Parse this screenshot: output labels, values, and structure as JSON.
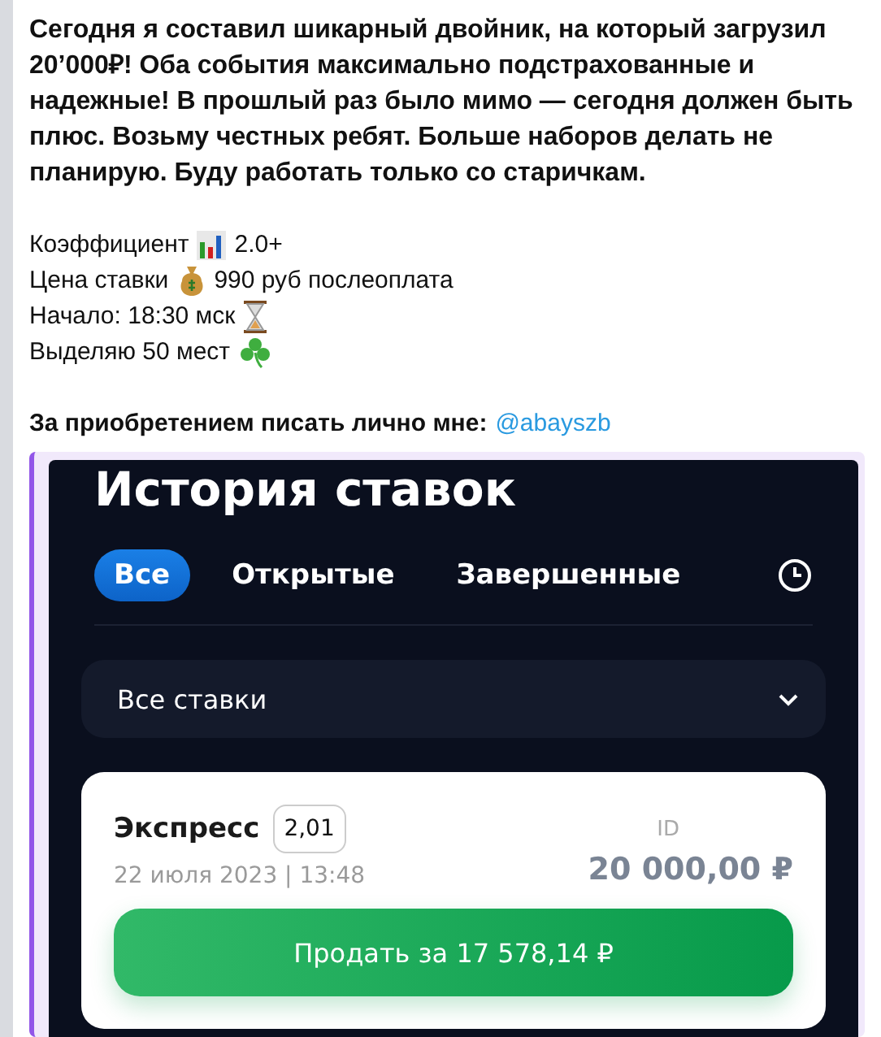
{
  "message": {
    "intro": "Сегодня я составил шикарный двойник, на который загрузил 20’000₽! Оба события максимально подстрахованные и надежные! В прошлый раз было мимо — сегодня должен быть плюс. Возьму честных ребят. Больше наборов делать не планирую. Буду работать только со старичкам.",
    "details": [
      {
        "kind": "chart",
        "before": "Коэффициент",
        "after": "2.0+"
      },
      {
        "kind": "moneybag",
        "before": "Цена ставки",
        "after": "990 руб послеоплата"
      },
      {
        "kind": "hourglass",
        "before": "Начало: 18:30 мск"
      },
      {
        "kind": "clover",
        "before": "Выделяю 50 мест"
      }
    ],
    "contact": {
      "text": "За приобретением писать лично мне:",
      "link": "@abayszb"
    }
  },
  "screenshot": {
    "title": "История ставок",
    "tabs": [
      {
        "label": "Все",
        "selected": true
      },
      {
        "label": "Открытые",
        "selected": false
      },
      {
        "label": "Завершенные",
        "selected": false
      }
    ],
    "filter": {
      "value": "Все ставки"
    },
    "bet": {
      "type": "Экспресс",
      "odds": "2,01",
      "date": "22 июля 2023 | 13:48",
      "id_label": "ID",
      "amount": "20 000,00 ₽",
      "sell_button": "Продать за 17 578,14 ₽"
    }
  }
}
